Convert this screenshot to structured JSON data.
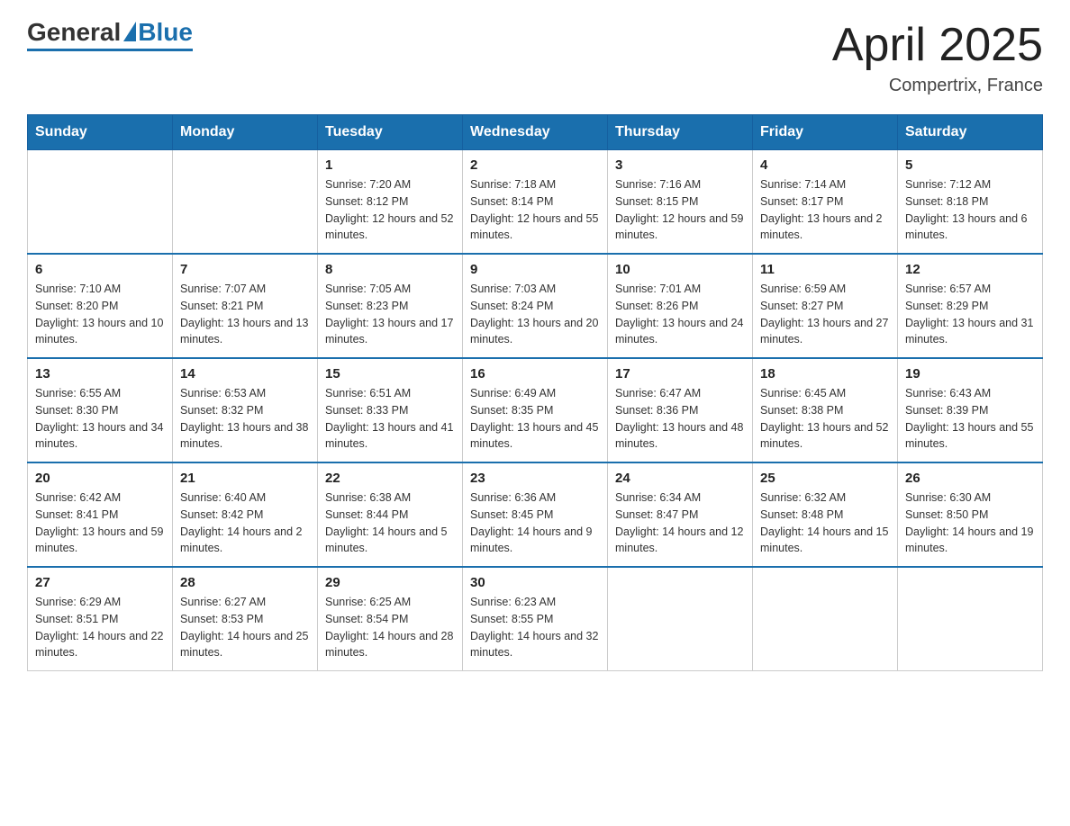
{
  "header": {
    "logo_general": "General",
    "logo_blue": "Blue",
    "month_title": "April 2025",
    "location": "Compertrix, France"
  },
  "weekdays": [
    "Sunday",
    "Monday",
    "Tuesday",
    "Wednesday",
    "Thursday",
    "Friday",
    "Saturday"
  ],
  "weeks": [
    [
      {
        "day": "",
        "sunrise": "",
        "sunset": "",
        "daylight": ""
      },
      {
        "day": "",
        "sunrise": "",
        "sunset": "",
        "daylight": ""
      },
      {
        "day": "1",
        "sunrise": "Sunrise: 7:20 AM",
        "sunset": "Sunset: 8:12 PM",
        "daylight": "Daylight: 12 hours and 52 minutes."
      },
      {
        "day": "2",
        "sunrise": "Sunrise: 7:18 AM",
        "sunset": "Sunset: 8:14 PM",
        "daylight": "Daylight: 12 hours and 55 minutes."
      },
      {
        "day": "3",
        "sunrise": "Sunrise: 7:16 AM",
        "sunset": "Sunset: 8:15 PM",
        "daylight": "Daylight: 12 hours and 59 minutes."
      },
      {
        "day": "4",
        "sunrise": "Sunrise: 7:14 AM",
        "sunset": "Sunset: 8:17 PM",
        "daylight": "Daylight: 13 hours and 2 minutes."
      },
      {
        "day": "5",
        "sunrise": "Sunrise: 7:12 AM",
        "sunset": "Sunset: 8:18 PM",
        "daylight": "Daylight: 13 hours and 6 minutes."
      }
    ],
    [
      {
        "day": "6",
        "sunrise": "Sunrise: 7:10 AM",
        "sunset": "Sunset: 8:20 PM",
        "daylight": "Daylight: 13 hours and 10 minutes."
      },
      {
        "day": "7",
        "sunrise": "Sunrise: 7:07 AM",
        "sunset": "Sunset: 8:21 PM",
        "daylight": "Daylight: 13 hours and 13 minutes."
      },
      {
        "day": "8",
        "sunrise": "Sunrise: 7:05 AM",
        "sunset": "Sunset: 8:23 PM",
        "daylight": "Daylight: 13 hours and 17 minutes."
      },
      {
        "day": "9",
        "sunrise": "Sunrise: 7:03 AM",
        "sunset": "Sunset: 8:24 PM",
        "daylight": "Daylight: 13 hours and 20 minutes."
      },
      {
        "day": "10",
        "sunrise": "Sunrise: 7:01 AM",
        "sunset": "Sunset: 8:26 PM",
        "daylight": "Daylight: 13 hours and 24 minutes."
      },
      {
        "day": "11",
        "sunrise": "Sunrise: 6:59 AM",
        "sunset": "Sunset: 8:27 PM",
        "daylight": "Daylight: 13 hours and 27 minutes."
      },
      {
        "day": "12",
        "sunrise": "Sunrise: 6:57 AM",
        "sunset": "Sunset: 8:29 PM",
        "daylight": "Daylight: 13 hours and 31 minutes."
      }
    ],
    [
      {
        "day": "13",
        "sunrise": "Sunrise: 6:55 AM",
        "sunset": "Sunset: 8:30 PM",
        "daylight": "Daylight: 13 hours and 34 minutes."
      },
      {
        "day": "14",
        "sunrise": "Sunrise: 6:53 AM",
        "sunset": "Sunset: 8:32 PM",
        "daylight": "Daylight: 13 hours and 38 minutes."
      },
      {
        "day": "15",
        "sunrise": "Sunrise: 6:51 AM",
        "sunset": "Sunset: 8:33 PM",
        "daylight": "Daylight: 13 hours and 41 minutes."
      },
      {
        "day": "16",
        "sunrise": "Sunrise: 6:49 AM",
        "sunset": "Sunset: 8:35 PM",
        "daylight": "Daylight: 13 hours and 45 minutes."
      },
      {
        "day": "17",
        "sunrise": "Sunrise: 6:47 AM",
        "sunset": "Sunset: 8:36 PM",
        "daylight": "Daylight: 13 hours and 48 minutes."
      },
      {
        "day": "18",
        "sunrise": "Sunrise: 6:45 AM",
        "sunset": "Sunset: 8:38 PM",
        "daylight": "Daylight: 13 hours and 52 minutes."
      },
      {
        "day": "19",
        "sunrise": "Sunrise: 6:43 AM",
        "sunset": "Sunset: 8:39 PM",
        "daylight": "Daylight: 13 hours and 55 minutes."
      }
    ],
    [
      {
        "day": "20",
        "sunrise": "Sunrise: 6:42 AM",
        "sunset": "Sunset: 8:41 PM",
        "daylight": "Daylight: 13 hours and 59 minutes."
      },
      {
        "day": "21",
        "sunrise": "Sunrise: 6:40 AM",
        "sunset": "Sunset: 8:42 PM",
        "daylight": "Daylight: 14 hours and 2 minutes."
      },
      {
        "day": "22",
        "sunrise": "Sunrise: 6:38 AM",
        "sunset": "Sunset: 8:44 PM",
        "daylight": "Daylight: 14 hours and 5 minutes."
      },
      {
        "day": "23",
        "sunrise": "Sunrise: 6:36 AM",
        "sunset": "Sunset: 8:45 PM",
        "daylight": "Daylight: 14 hours and 9 minutes."
      },
      {
        "day": "24",
        "sunrise": "Sunrise: 6:34 AM",
        "sunset": "Sunset: 8:47 PM",
        "daylight": "Daylight: 14 hours and 12 minutes."
      },
      {
        "day": "25",
        "sunrise": "Sunrise: 6:32 AM",
        "sunset": "Sunset: 8:48 PM",
        "daylight": "Daylight: 14 hours and 15 minutes."
      },
      {
        "day": "26",
        "sunrise": "Sunrise: 6:30 AM",
        "sunset": "Sunset: 8:50 PM",
        "daylight": "Daylight: 14 hours and 19 minutes."
      }
    ],
    [
      {
        "day": "27",
        "sunrise": "Sunrise: 6:29 AM",
        "sunset": "Sunset: 8:51 PM",
        "daylight": "Daylight: 14 hours and 22 minutes."
      },
      {
        "day": "28",
        "sunrise": "Sunrise: 6:27 AM",
        "sunset": "Sunset: 8:53 PM",
        "daylight": "Daylight: 14 hours and 25 minutes."
      },
      {
        "day": "29",
        "sunrise": "Sunrise: 6:25 AM",
        "sunset": "Sunset: 8:54 PM",
        "daylight": "Daylight: 14 hours and 28 minutes."
      },
      {
        "day": "30",
        "sunrise": "Sunrise: 6:23 AM",
        "sunset": "Sunset: 8:55 PM",
        "daylight": "Daylight: 14 hours and 32 minutes."
      },
      {
        "day": "",
        "sunrise": "",
        "sunset": "",
        "daylight": ""
      },
      {
        "day": "",
        "sunrise": "",
        "sunset": "",
        "daylight": ""
      },
      {
        "day": "",
        "sunrise": "",
        "sunset": "",
        "daylight": ""
      }
    ]
  ]
}
